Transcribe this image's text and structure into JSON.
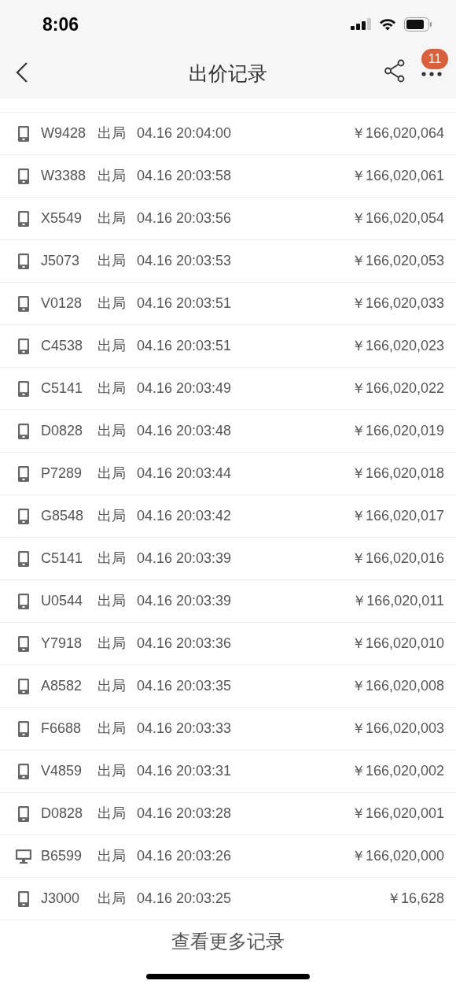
{
  "status_bar": {
    "time": "8:06"
  },
  "nav": {
    "title": "出价记录",
    "badge": "11"
  },
  "bids": [
    {
      "kind": "mobile",
      "bidder": "W9428",
      "status": "出局",
      "time": "04.16 20:04:00",
      "price": "￥166,020,064"
    },
    {
      "kind": "mobile",
      "bidder": "W3388",
      "status": "出局",
      "time": "04.16 20:03:58",
      "price": "￥166,020,061"
    },
    {
      "kind": "mobile",
      "bidder": "X5549",
      "status": "出局",
      "time": "04.16 20:03:56",
      "price": "￥166,020,054"
    },
    {
      "kind": "mobile",
      "bidder": "J5073",
      "status": "出局",
      "time": "04.16 20:03:53",
      "price": "￥166,020,053"
    },
    {
      "kind": "mobile",
      "bidder": "V0128",
      "status": "出局",
      "time": "04.16 20:03:51",
      "price": "￥166,020,033"
    },
    {
      "kind": "mobile",
      "bidder": "C4538",
      "status": "出局",
      "time": "04.16 20:03:51",
      "price": "￥166,020,023"
    },
    {
      "kind": "mobile",
      "bidder": "C5141",
      "status": "出局",
      "time": "04.16 20:03:49",
      "price": "￥166,020,022"
    },
    {
      "kind": "mobile",
      "bidder": "D0828",
      "status": "出局",
      "time": "04.16 20:03:48",
      "price": "￥166,020,019"
    },
    {
      "kind": "mobile",
      "bidder": "P7289",
      "status": "出局",
      "time": "04.16 20:03:44",
      "price": "￥166,020,018"
    },
    {
      "kind": "mobile",
      "bidder": "G8548",
      "status": "出局",
      "time": "04.16 20:03:42",
      "price": "￥166,020,017"
    },
    {
      "kind": "mobile",
      "bidder": "C5141",
      "status": "出局",
      "time": "04.16 20:03:39",
      "price": "￥166,020,016"
    },
    {
      "kind": "mobile",
      "bidder": "U0544",
      "status": "出局",
      "time": "04.16 20:03:39",
      "price": "￥166,020,011"
    },
    {
      "kind": "mobile",
      "bidder": "Y7918",
      "status": "出局",
      "time": "04.16 20:03:36",
      "price": "￥166,020,010"
    },
    {
      "kind": "mobile",
      "bidder": "A8582",
      "status": "出局",
      "time": "04.16 20:03:35",
      "price": "￥166,020,008"
    },
    {
      "kind": "mobile",
      "bidder": "F6688",
      "status": "出局",
      "time": "04.16 20:03:33",
      "price": "￥166,020,003"
    },
    {
      "kind": "mobile",
      "bidder": "V4859",
      "status": "出局",
      "time": "04.16 20:03:31",
      "price": "￥166,020,002"
    },
    {
      "kind": "mobile",
      "bidder": "D0828",
      "status": "出局",
      "time": "04.16 20:03:28",
      "price": "￥166,020,001"
    },
    {
      "kind": "desktop",
      "bidder": "B6599",
      "status": "出局",
      "time": "04.16 20:03:26",
      "price": "￥166,020,000"
    },
    {
      "kind": "mobile",
      "bidder": "J3000",
      "status": "出局",
      "time": "04.16 20:03:25",
      "price": "￥16,628"
    }
  ],
  "more_link": "查看更多记录"
}
